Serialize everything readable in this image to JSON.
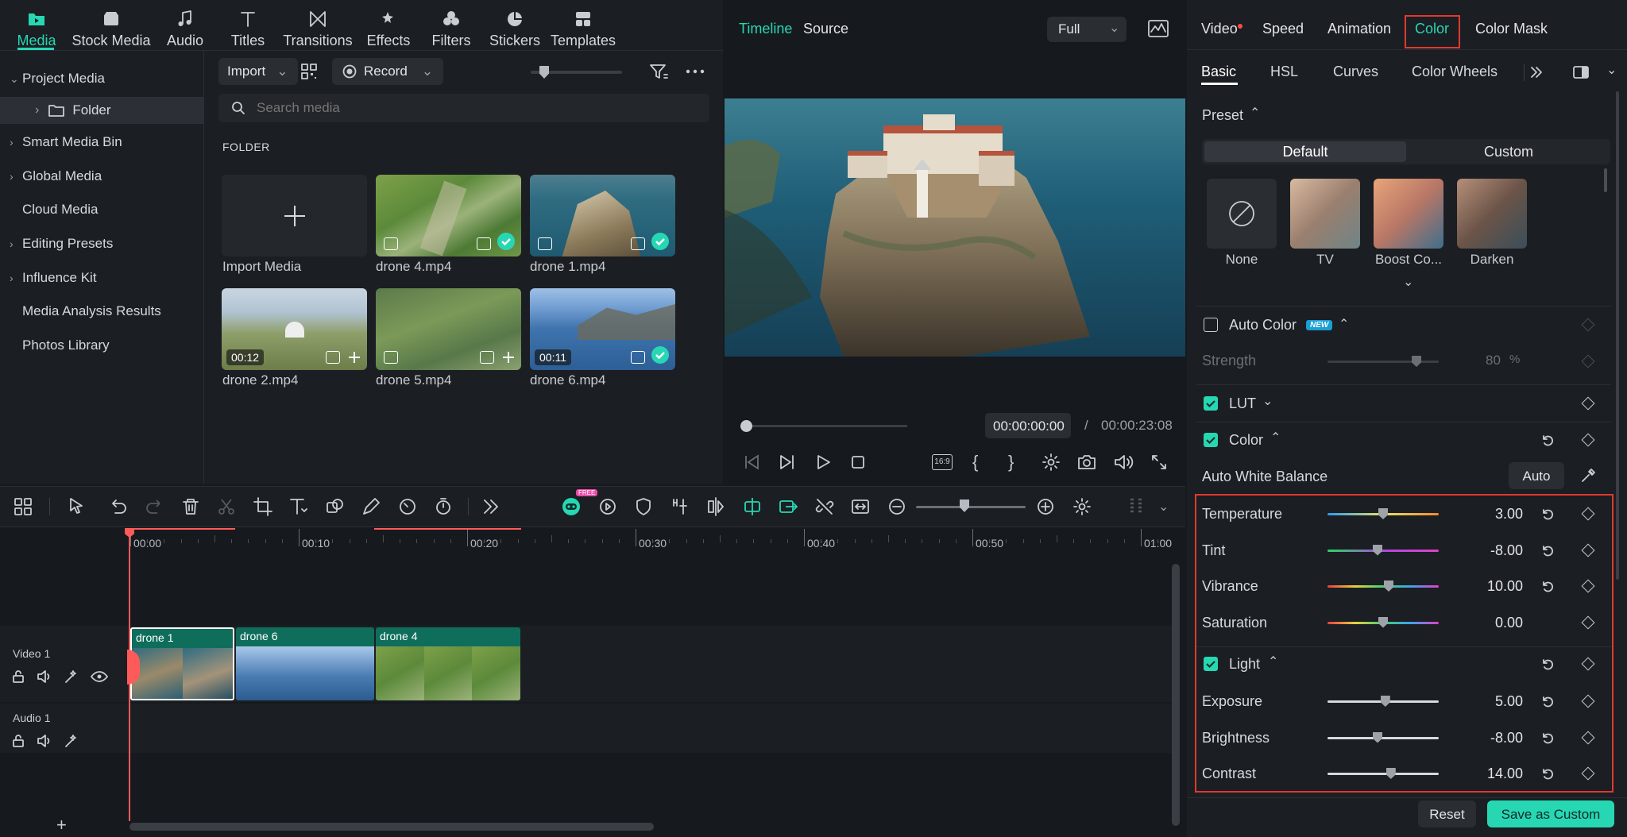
{
  "media_tabs": [
    {
      "label": "Media",
      "icon": "folder-icon",
      "active": true
    },
    {
      "label": "Stock Media",
      "icon": "stock-media-icon"
    },
    {
      "label": "Audio",
      "icon": "music-note-icon"
    },
    {
      "label": "Titles",
      "icon": "text-icon"
    },
    {
      "label": "Transitions",
      "icon": "transition-icon"
    },
    {
      "label": "Effects",
      "icon": "effects-icon"
    },
    {
      "label": "Filters",
      "icon": "filters-icon"
    },
    {
      "label": "Stickers",
      "icon": "sticker-icon"
    },
    {
      "label": "Templates",
      "icon": "templates-icon"
    }
  ],
  "library": {
    "items": [
      "Project Media",
      "Folder",
      "Smart Media Bin",
      "Global Media",
      "Cloud Media",
      "Editing Presets",
      "Influence Kit",
      "Media Analysis Results",
      "Photos Library"
    ]
  },
  "media_toolbar": {
    "import_label": "Import",
    "record_label": "Record",
    "search_placeholder": "Search media"
  },
  "folder": {
    "heading": "FOLDER",
    "import_label": "Import Media",
    "clips": [
      {
        "name": "drone 4.mp4",
        "duration": "",
        "added": true
      },
      {
        "name": "drone 1.mp4",
        "duration": "",
        "added": true
      },
      {
        "name": "drone 2.mp4",
        "duration": "00:12",
        "added": false
      },
      {
        "name": "drone 5.mp4",
        "duration": "",
        "added": false
      },
      {
        "name": "drone 6.mp4",
        "duration": "00:11",
        "added": true
      }
    ]
  },
  "preview": {
    "tabs": [
      "Timeline",
      "Source"
    ],
    "quality": "Full",
    "current_time": "00:00:00:00",
    "separator": "/",
    "total_time": "00:00:23:08",
    "aspect_label": "16:9",
    "brace_open": "{",
    "brace_close": "}"
  },
  "properties": {
    "tabs": [
      "Video",
      "Speed",
      "Animation",
      "Color",
      "Color Mask"
    ],
    "active_tab": "Color",
    "sub_tabs": [
      "Basic",
      "HSL",
      "Curves",
      "Color Wheels"
    ],
    "preset_label": "Preset",
    "preset_toggle": [
      "Default",
      "Custom"
    ],
    "presets": [
      "None",
      "TV",
      "Boost Co...",
      "Darken"
    ],
    "auto_color": {
      "label": "Auto Color",
      "badge": "NEW",
      "strength_label": "Strength",
      "strength_value": "80",
      "strength_unit": "%",
      "strength_fraction": 0.8
    },
    "lut_label": "LUT",
    "color_section": "Color",
    "awb_label": "Auto White Balance",
    "awb_button": "Auto",
    "color_sliders": [
      {
        "label": "Temperature",
        "value": "3.00",
        "pos": 0.5
      },
      {
        "label": "Tint",
        "value": "-8.00",
        "pos": 0.45
      },
      {
        "label": "Vibrance",
        "value": "10.00",
        "pos": 0.55
      },
      {
        "label": "Saturation",
        "value": "0.00",
        "pos": 0.5
      }
    ],
    "light_section": "Light",
    "light_sliders": [
      {
        "label": "Exposure",
        "value": "5.00",
        "pos": 0.52
      },
      {
        "label": "Brightness",
        "value": "-8.00",
        "pos": 0.45
      },
      {
        "label": "Contrast",
        "value": "14.00",
        "pos": 0.57
      }
    ],
    "reset_button": "Reset",
    "save_button": "Save as Custom"
  },
  "timeline": {
    "ruler": [
      "00:00",
      "00:10",
      "00:20",
      "00:30",
      "00:40",
      "00:50",
      "01:00"
    ],
    "free_badge": "FREE",
    "video_track": "Video 1",
    "audio_track": "Audio 1",
    "clips": [
      "drone 1",
      "drone 6",
      "drone 4"
    ],
    "add_icon": "+"
  },
  "colors": {
    "accent": "#27d7b4",
    "highlight_box": "#e03a2f",
    "playhead": "#ff5a5a"
  }
}
